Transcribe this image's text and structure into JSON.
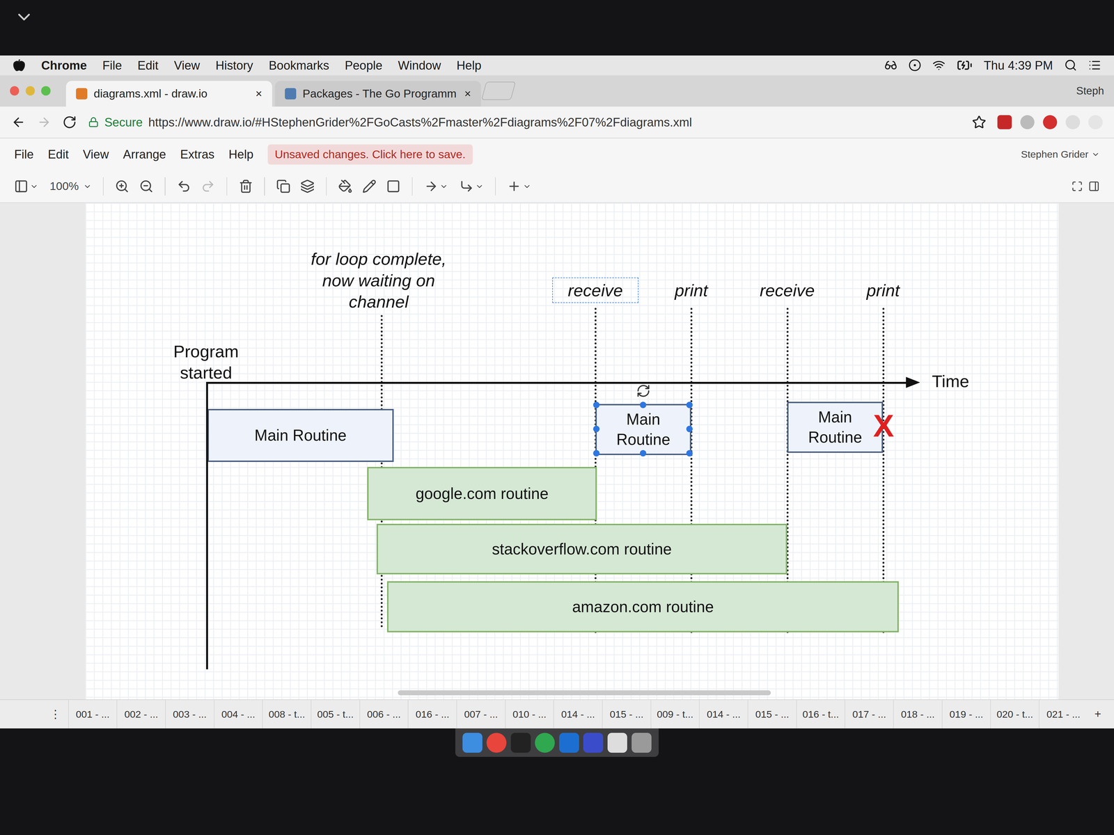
{
  "menubar": {
    "app": "Chrome",
    "items": [
      "File",
      "Edit",
      "View",
      "History",
      "Bookmarks",
      "People",
      "Window",
      "Help"
    ],
    "clock": "Thu 4:39 PM"
  },
  "tabs": [
    {
      "label": "diagrams.xml - draw.io",
      "close": "×",
      "selected": true
    },
    {
      "label": "Packages - The Go Programm",
      "close": "×",
      "selected": false
    }
  ],
  "profile": "Steph",
  "address": {
    "secure": "Secure",
    "url": "https://www.draw.io/#HStephenGrider%2FGoCasts%2Fmaster%2Fdiagrams%2F07%2Fdiagrams.xml"
  },
  "drawio": {
    "menu": [
      "File",
      "Edit",
      "View",
      "Arrange",
      "Extras",
      "Help"
    ],
    "notice": "Unsaved changes. Click here to save.",
    "user": "Stephen Grider",
    "zoom": "100%"
  },
  "diagram": {
    "start": "Program started",
    "waiting": "for loop complete, now waiting on channel",
    "axis": "Time",
    "events": [
      {
        "label": "receive",
        "selected": true
      },
      {
        "label": "print",
        "selected": false
      },
      {
        "label": "receive",
        "selected": false
      },
      {
        "label": "print",
        "selected": false
      }
    ],
    "main_routines": [
      {
        "label": "Main Routine",
        "selected": false,
        "crossed": false
      },
      {
        "label": "Main Routine",
        "selected": true,
        "crossed": false
      },
      {
        "label": "Main Routine",
        "selected": false,
        "crossed": true
      }
    ],
    "mark": "X",
    "routines": [
      {
        "label": "google.com routine"
      },
      {
        "label": "stackoverflow.com routine"
      },
      {
        "label": "amazon.com routine"
      }
    ]
  },
  "pages": [
    {
      "label": "001 - ..."
    },
    {
      "label": "002 - ..."
    },
    {
      "label": "003 - ..."
    },
    {
      "label": "004 - ..."
    },
    {
      "label": "008 - t..."
    },
    {
      "label": "005 - t..."
    },
    {
      "label": "006 - ..."
    },
    {
      "label": "016 - ..."
    },
    {
      "label": "007 - ..."
    },
    {
      "label": "010 - ..."
    },
    {
      "label": "014 - ..."
    },
    {
      "label": "015 - ..."
    },
    {
      "label": "009 - t..."
    },
    {
      "label": "014 - ..."
    },
    {
      "label": "015 - ..."
    },
    {
      "label": "016 - t..."
    },
    {
      "label": "017 - ..."
    },
    {
      "label": "018 - ..."
    },
    {
      "label": "019 - ..."
    },
    {
      "label": "020 - t..."
    },
    {
      "label": "021 - ..."
    }
  ],
  "page_menu": "⋮",
  "add_page": "+"
}
